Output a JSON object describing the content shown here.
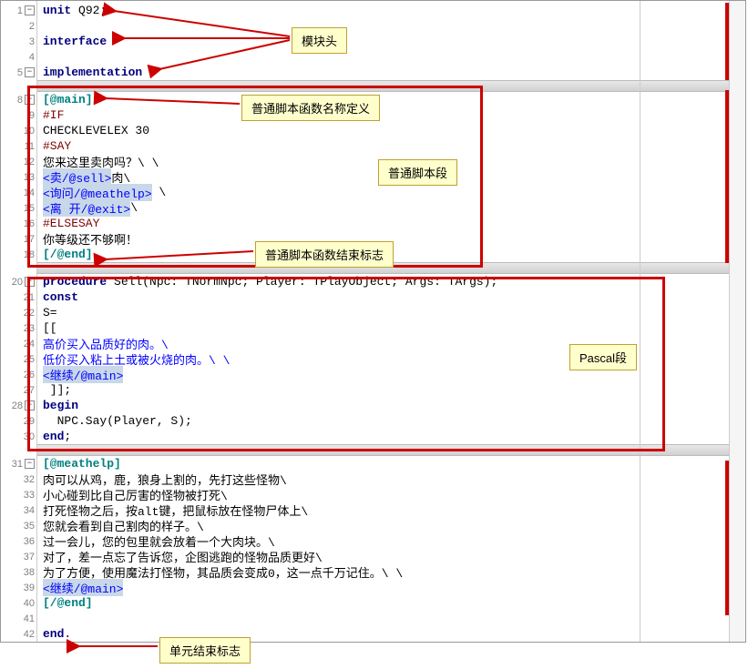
{
  "lines": {
    "l1": {
      "num": "1",
      "kw": "unit",
      "rest": " Q92;"
    },
    "l2": {
      "num": "2"
    },
    "l3": {
      "num": "3",
      "kw": "interface"
    },
    "l4": {
      "num": "4"
    },
    "l5": {
      "num": "5",
      "kw": "implementation"
    },
    "l8": {
      "num": "8",
      "dir": "[@main]"
    },
    "l9": {
      "num": "9",
      "pre": "#IF"
    },
    "l10": {
      "num": "10",
      "txt": "CHECKLEVELEX 30"
    },
    "l11": {
      "num": "11",
      "pre": "#SAY"
    },
    "l12": {
      "num": "12",
      "txt": "您来这里卖肉吗？\\ \\"
    },
    "l13": {
      "num": "13",
      "link": "<卖/@sell>",
      "txt": "肉\\"
    },
    "l14": {
      "num": "14",
      "link": "<询问/@meathelp>",
      "txt": " \\"
    },
    "l15": {
      "num": "15",
      "link": "<离 开/@exit>",
      "txt": "\\"
    },
    "l16": {
      "num": "16",
      "pre": "#ELSESAY"
    },
    "l17": {
      "num": "17",
      "txt": "你等级还不够啊！"
    },
    "l18": {
      "num": "18",
      "dir": "[/@end]"
    },
    "l20": {
      "num": "20",
      "proc_kw": "procedure",
      "proc_name": " Sell(Npc: TNormNpc; Player: TPlayObject; Args: TArgs);"
    },
    "l21": {
      "num": "21",
      "kw": "const"
    },
    "l22": {
      "num": "22",
      "txt": "S="
    },
    "l23": {
      "num": "23",
      "txt": "[["
    },
    "l24": {
      "num": "24",
      "str": "高价买入品质好的肉。\\"
    },
    "l25": {
      "num": "25",
      "str": "低价买入粘上土或被火烧的肉。\\ \\"
    },
    "l26": {
      "num": "26",
      "link": "<继续/@main>"
    },
    "l27": {
      "num": "27",
      "txt": " ]];"
    },
    "l28": {
      "num": "28",
      "kw": "begin"
    },
    "l29": {
      "num": "29",
      "txt": "  NPC.Say(Player, S);"
    },
    "l30": {
      "num": "30",
      "kw": "end",
      "semi": ";"
    },
    "l31": {
      "num": "31",
      "dir": "[@meathelp]"
    },
    "l32": {
      "num": "32",
      "txt": "肉可以从鸡，鹿，狼身上割的，先打这些怪物\\"
    },
    "l33": {
      "num": "33",
      "txt": "小心碰到比自己厉害的怪物被打死\\"
    },
    "l34": {
      "num": "34",
      "txt": "打死怪物之后，按alt键，把鼠标放在怪物尸体上\\"
    },
    "l35": {
      "num": "35",
      "txt": "您就会看到自己割肉的样子。\\"
    },
    "l36": {
      "num": "36",
      "txt": "过一会儿，您的包里就会放着一个大肉块。\\"
    },
    "l37": {
      "num": "37",
      "txt": "对了，差一点忘了告诉您，企图逃跑的怪物品质更好\\"
    },
    "l38": {
      "num": "38",
      "txt": "为了方便，使用魔法打怪物，其品质会变成0，这一点千万记住。\\ \\"
    },
    "l39": {
      "num": "39",
      "link": "<继续/@main>"
    },
    "l40": {
      "num": "40",
      "dir": "[/@end]"
    },
    "l41": {
      "num": "41"
    },
    "l42": {
      "num": "42",
      "kw": "end",
      "dot": "."
    }
  },
  "labels": {
    "module_header": "模块头",
    "func_name_def": "普通脚本函数名称定义",
    "script_section": "普通脚本段",
    "func_end_marker": "普通脚本函数结束标志",
    "pascal_section": "Pascal段",
    "unit_end_marker": "单元结束标志"
  },
  "fold_symbol": "−"
}
